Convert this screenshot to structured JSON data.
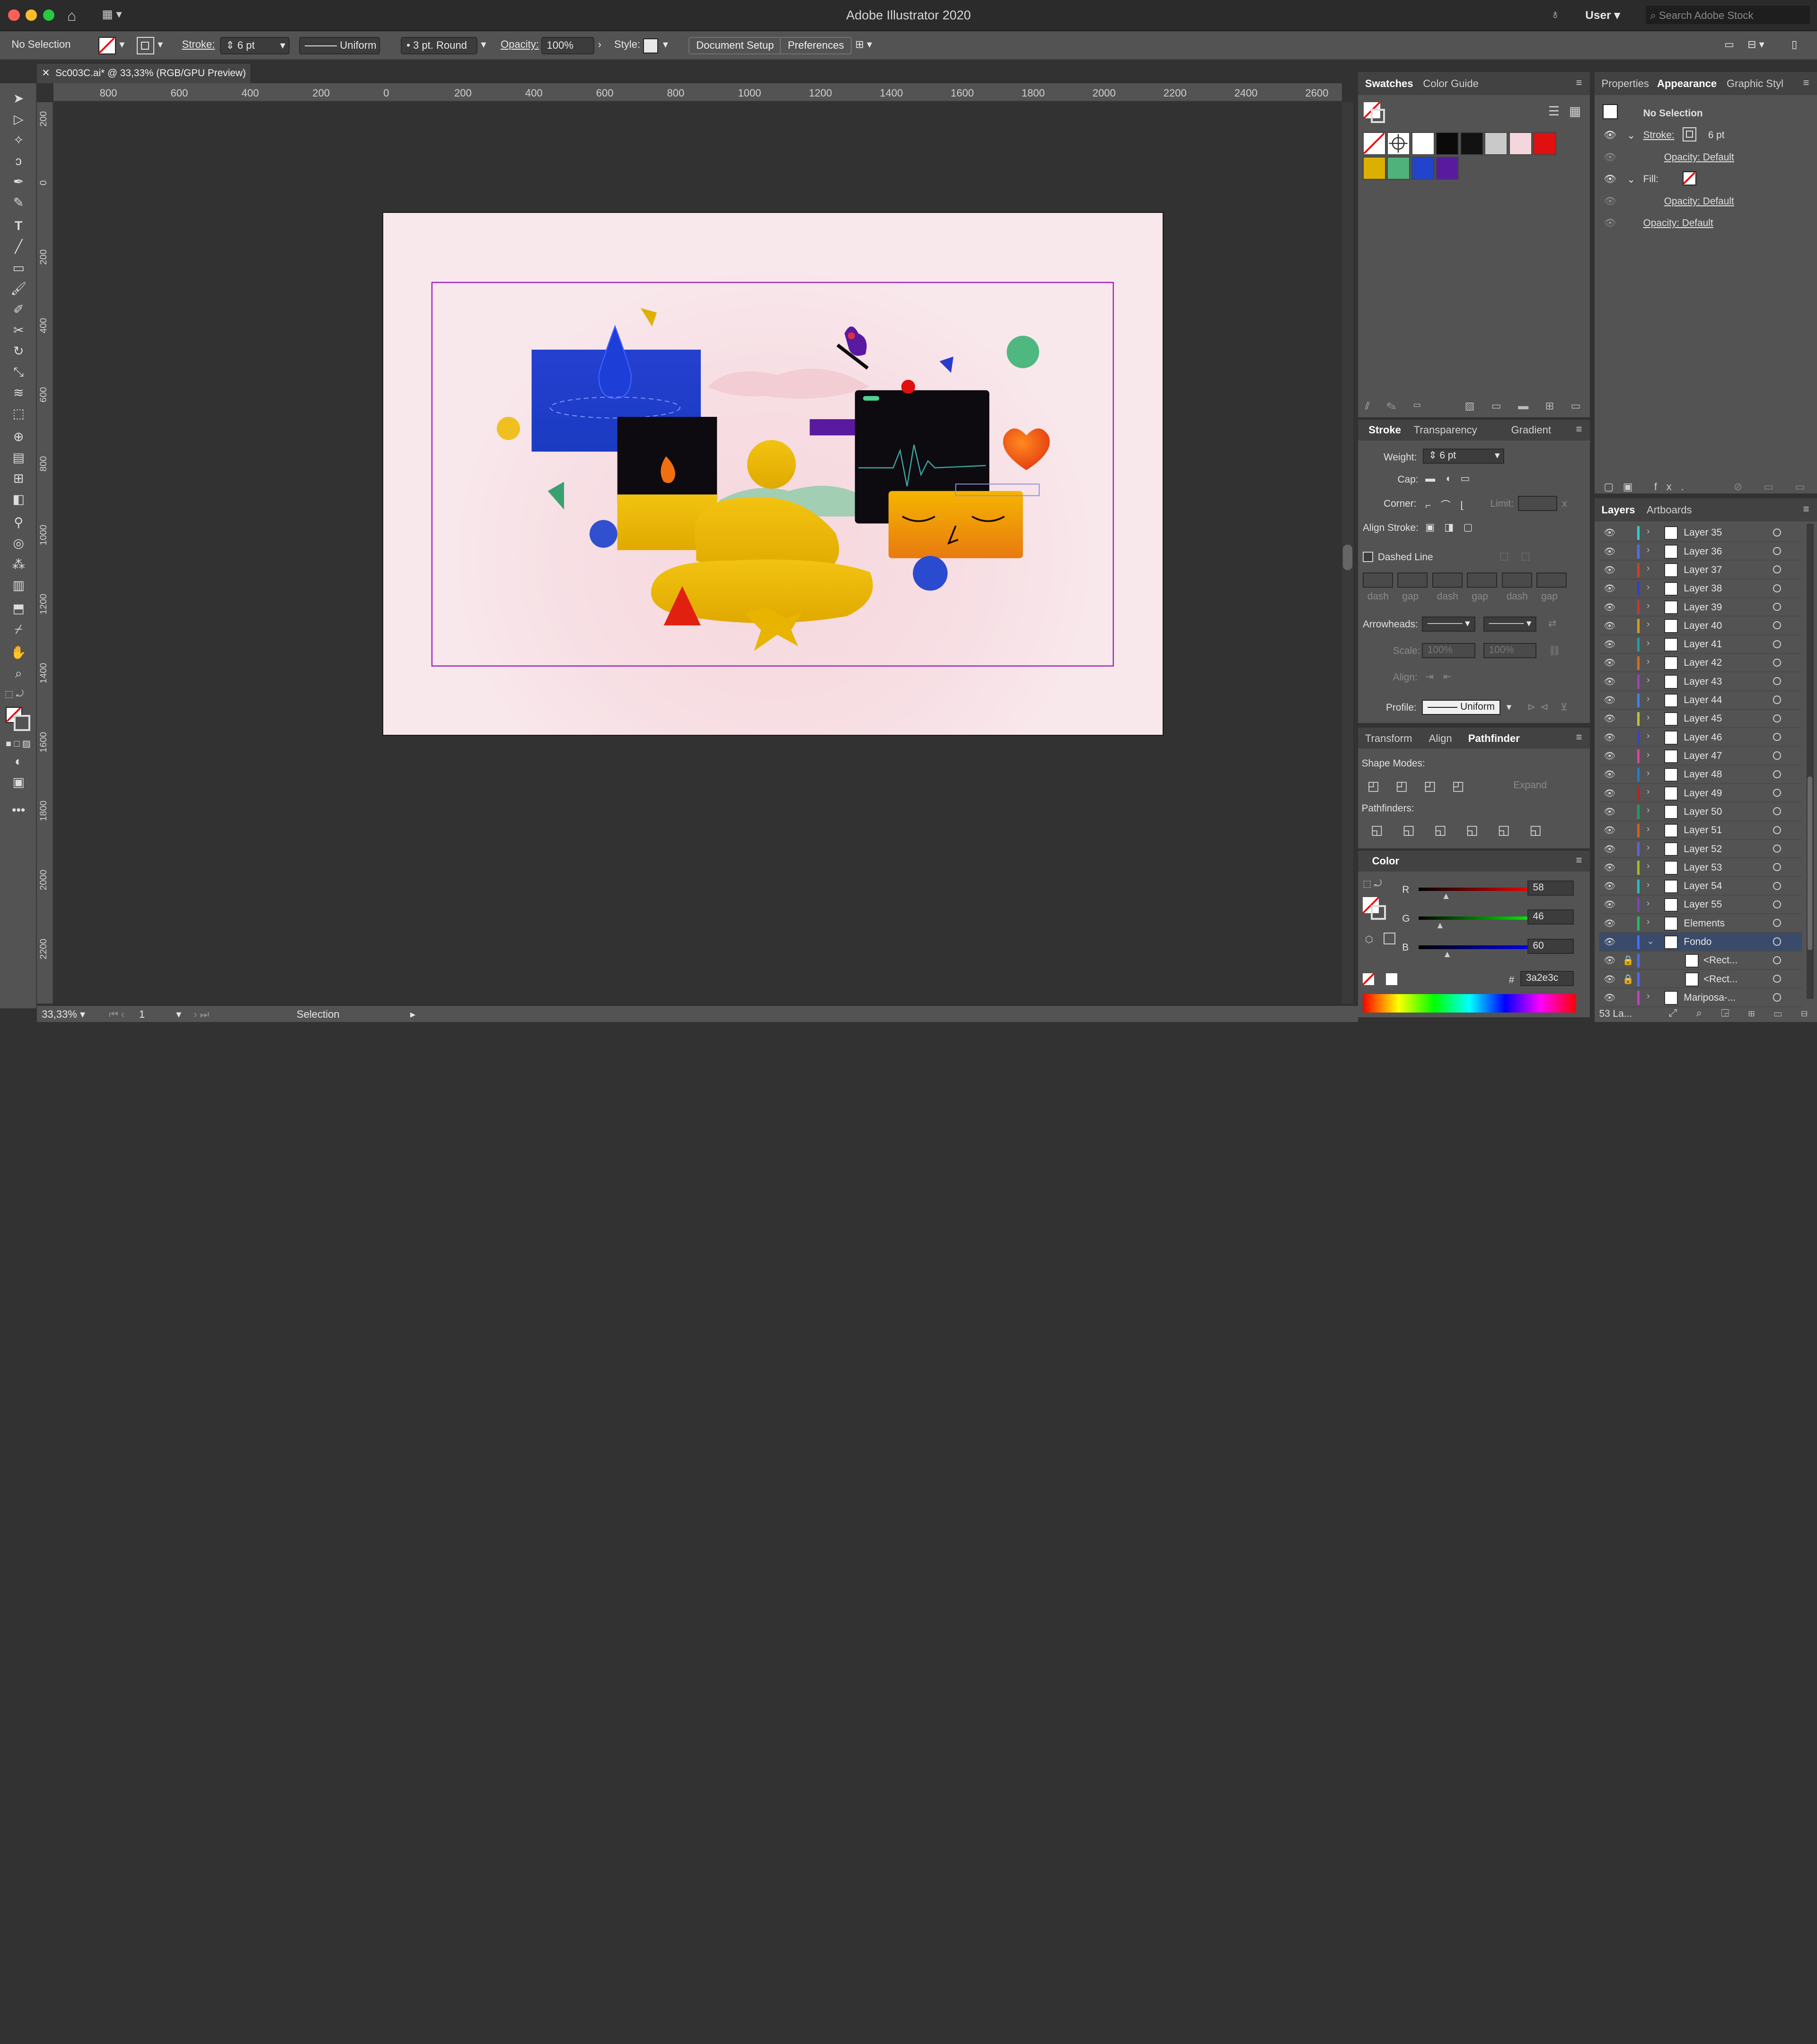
{
  "window": {
    "title": "Adobe Illustrator 2020",
    "user": "User",
    "search_placeholder": "Search Adobe Stock"
  },
  "control_bar": {
    "selection": "No Selection",
    "stroke_label": "Stroke:",
    "stroke_weight": "6 pt",
    "stroke_style": "Uniform",
    "brush": "3 pt. Round",
    "opacity_label": "Opacity:",
    "opacity_value": "100%",
    "style_label": "Style:",
    "document_setup": "Document Setup",
    "preferences": "Preferences"
  },
  "document_tab": {
    "title": "Sc003C.ai* @ 33,33% (RGB/GPU Preview)"
  },
  "ruler_h": [
    "800",
    "600",
    "400",
    "200",
    "0",
    "200",
    "400",
    "600",
    "800",
    "1000",
    "1200",
    "1400",
    "1600",
    "1800",
    "2000",
    "2200",
    "2400",
    "2600"
  ],
  "ruler_v": [
    "200",
    "0",
    "200",
    "400",
    "600",
    "800",
    "1000",
    "1200",
    "1400",
    "1600",
    "1800",
    "2000",
    "2200"
  ],
  "status": {
    "zoom": "33,33%",
    "artboard": "1",
    "tool": "Selection"
  },
  "swatches_panel": {
    "tabs": [
      "Swatches",
      "Color Guide"
    ]
  },
  "swatch_colors": [
    "#ffffff",
    "#0a0a0a",
    "#121212",
    "#c9c9c9",
    "#f4d6dc",
    "#e01010",
    "#dcb000",
    "#4fb27a",
    "#2244cc",
    "#5a1aa0"
  ],
  "stroke_panel": {
    "tabs": [
      "Stroke",
      "Transparency",
      "Gradient"
    ],
    "weight_label": "Weight:",
    "weight": "6 pt",
    "cap_label": "Cap:",
    "corner_label": "Corner:",
    "limit_label": "Limit:",
    "limit_x": "x",
    "align_label": "Align Stroke:",
    "dashed": "Dashed Line",
    "dash_labels": [
      "dash",
      "gap",
      "dash",
      "gap",
      "dash",
      "gap"
    ],
    "arrowheads_label": "Arrowheads:",
    "scale_label": "Scale:",
    "scale_1": "100%",
    "scale_2": "100%",
    "align2_label": "Align:",
    "profile_label": "Profile:",
    "profile": "Uniform"
  },
  "pathfinder_panel": {
    "tabs": [
      "Transform",
      "Align",
      "Pathfinder"
    ],
    "shape_modes": "Shape Modes:",
    "expand": "Expand",
    "pathfinders": "Pathfinders:"
  },
  "color_panel": {
    "tab": "Color",
    "r": "58",
    "g": "46",
    "b": "60",
    "hex": "3a2e3c",
    "r_label": "R",
    "g_label": "G",
    "b_label": "B",
    "hash": "#",
    "r_frac": 0.23,
    "g_frac": 0.18,
    "b_frac": 0.24
  },
  "properties_panel": {
    "tabs": [
      "Properties",
      "Appearance",
      "Graphic Styl"
    ],
    "selection": "No Selection",
    "stroke_label": "Stroke:",
    "stroke_value": "6 pt",
    "opacity_1": "Opacity: Default",
    "fill_label": "Fill:",
    "opacity_2": "Opacity: Default",
    "opacity_3": "Opacity: Default"
  },
  "layers_panel": {
    "tabs": [
      "Layers",
      "Artboards"
    ],
    "count": "53 La...",
    "rows": [
      {
        "name": "Layer 35",
        "color": "#2bd0d0"
      },
      {
        "name": "Layer 36",
        "color": "#4d6cff"
      },
      {
        "name": "Layer 37",
        "color": "#d04020"
      },
      {
        "name": "Layer 38",
        "color": "#3a3ad0"
      },
      {
        "name": "Layer 39",
        "color": "#c33"
      },
      {
        "name": "Layer 40",
        "color": "#d0a020"
      },
      {
        "name": "Layer 41",
        "color": "#20a0a0"
      },
      {
        "name": "Layer 42",
        "color": "#d07020"
      },
      {
        "name": "Layer 43",
        "color": "#a040c0"
      },
      {
        "name": "Layer 44",
        "color": "#4080ff"
      },
      {
        "name": "Layer 45",
        "color": "#c0c040"
      },
      {
        "name": "Layer 46",
        "color": "#4040c0"
      },
      {
        "name": "Layer 47",
        "color": "#e040a0"
      },
      {
        "name": "Layer 48",
        "color": "#2080d0"
      },
      {
        "name": "Layer 49",
        "color": "#c02020"
      },
      {
        "name": "Layer 50",
        "color": "#20a060"
      },
      {
        "name": "Layer 51",
        "color": "#d06020"
      },
      {
        "name": "Layer 52",
        "color": "#6060e0"
      },
      {
        "name": "Layer 53",
        "color": "#a0c020"
      },
      {
        "name": "Layer 54",
        "color": "#20c0c0"
      },
      {
        "name": "Layer 55",
        "color": "#8040c0"
      },
      {
        "name": "Elements",
        "color": "#20c060"
      },
      {
        "name": "Fondo",
        "color": "#4a6cff"
      },
      {
        "name": "<Rect...",
        "color": "#4a6cff"
      },
      {
        "name": "<Rect...",
        "color": "#4a6cff"
      },
      {
        "name": "Mariposa-...",
        "color": "#c040c0"
      }
    ]
  }
}
